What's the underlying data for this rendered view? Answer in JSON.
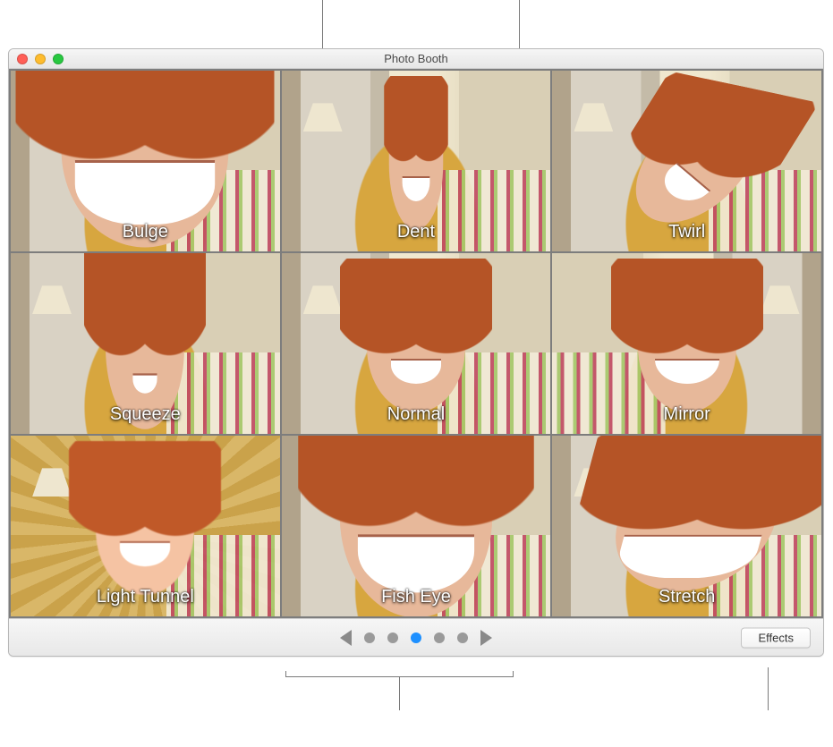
{
  "window_title": "Photo Booth",
  "effects_grid": [
    {
      "label": "Bulge",
      "fx": "fx-bulge"
    },
    {
      "label": "Dent",
      "fx": "fx-dent"
    },
    {
      "label": "Twirl",
      "fx": "fx-twirl"
    },
    {
      "label": "Squeeze",
      "fx": "fx-squeeze"
    },
    {
      "label": "Normal",
      "fx": ""
    },
    {
      "label": "Mirror",
      "fx": "fx-mirror"
    },
    {
      "label": "Light Tunnel",
      "fx": "fx-light"
    },
    {
      "label": "Fish Eye",
      "fx": "fx-fish"
    },
    {
      "label": "Stretch",
      "fx": "fx-stretch"
    }
  ],
  "pager": {
    "page_count": 5,
    "active_index": 2
  },
  "effects_button_label": "Effects",
  "colors": {
    "traffic_red": "#ff5f57",
    "traffic_yellow": "#febc2e",
    "traffic_green": "#28c840",
    "pager_active": "#1e90ff"
  }
}
